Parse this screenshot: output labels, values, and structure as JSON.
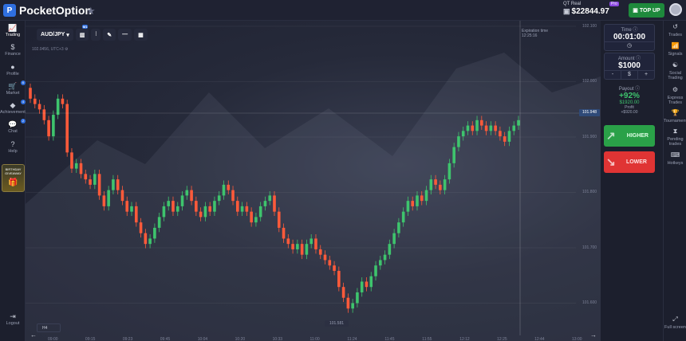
{
  "header": {
    "brand": "PocketOption",
    "brand_letter": "P",
    "account_type": "QT Real",
    "account_pro": "Pro",
    "balance": "$22844.97",
    "topup_label": "TOP UP"
  },
  "sidebar": {
    "items": [
      {
        "label": "Trading",
        "icon": "chart-line-icon",
        "glyph": "📈"
      },
      {
        "label": "Finance",
        "icon": "dollar-icon",
        "glyph": "$"
      },
      {
        "label": "Profile",
        "icon": "user-icon",
        "glyph": "●"
      },
      {
        "label": "Market",
        "icon": "cart-icon",
        "glyph": "🛒",
        "badge": "6"
      },
      {
        "label": "Achievements",
        "icon": "diamond-icon",
        "glyph": "◆",
        "badge": "4"
      },
      {
        "label": "Chat",
        "icon": "chat-icon",
        "glyph": "💬",
        "badge": "2"
      },
      {
        "label": "Help",
        "icon": "help-icon",
        "glyph": "?"
      }
    ],
    "promo": "BIRTHDAY GIVEAWAY",
    "logout": "Logout"
  },
  "toolbar": {
    "pair": "AUD/JPY",
    "badge": "M1"
  },
  "chart_info": {
    "subtitle": "102.0456, UTC+3",
    "expiration_label": "Expiration time",
    "expiration_time": "12:25:16",
    "timeframe": "H4",
    "current_price": "101.948",
    "low_price": "101.581"
  },
  "panel": {
    "time_title": "Time",
    "time_value": "00:01:00",
    "amount_title": "Amount",
    "amount_value": "$1000",
    "amount_minus": "-",
    "amount_currency": "$",
    "amount_plus": "+",
    "payout_title": "Payout",
    "payout_pct": "+92%",
    "payout_amount": "$1920.00",
    "profit_label": "Profit",
    "profit_amount": "+$920.00",
    "higher_label": "HIGHER",
    "lower_label": "LOWER"
  },
  "rightnav": {
    "items": [
      {
        "label": "Trades",
        "icon": "history-icon",
        "glyph": "↺"
      },
      {
        "label": "Signals",
        "icon": "signal-icon",
        "glyph": "📶"
      },
      {
        "label": "Social Trading",
        "icon": "social-icon",
        "glyph": "☯"
      },
      {
        "label": "Express Trades",
        "icon": "express-icon",
        "glyph": "⚙"
      },
      {
        "label": "Tournaments",
        "icon": "trophy-icon",
        "glyph": "🏆"
      },
      {
        "label": "Pending trades",
        "icon": "hourglass-icon",
        "glyph": "⧗"
      },
      {
        "label": "Hotkeys",
        "icon": "keyboard-icon",
        "glyph": "⌨"
      }
    ],
    "fullscreen": "Full screen"
  },
  "axis": {
    "y_ticks": [
      "102.100",
      "102.000",
      "101.900",
      "101.800",
      "101.700",
      "101.600"
    ],
    "x_ticks": [
      "09:00",
      "09:15",
      "09:23",
      "09:45",
      "10:04",
      "10:20",
      "10:33",
      "11:00",
      "11:24",
      "11:45",
      "11:55",
      "12:12",
      "12:25",
      "12:44",
      "13:00"
    ]
  },
  "chart_data": {
    "type": "candlestick",
    "title": "AUD/JPY",
    "ylim": [
      101.55,
      102.12
    ],
    "colors": {
      "up": "#3ec46d",
      "down": "#ff5a3a"
    },
    "closes": [
      101.99,
      101.98,
      101.97,
      101.95,
      101.92,
      101.96,
      101.99,
      101.98,
      101.89,
      101.86,
      101.87,
      101.85,
      101.84,
      101.83,
      101.85,
      101.81,
      101.79,
      101.82,
      101.84,
      101.82,
      101.8,
      101.78,
      101.79,
      101.76,
      101.74,
      101.72,
      101.73,
      101.75,
      101.77,
      101.79,
      101.8,
      101.78,
      101.79,
      101.81,
      101.82,
      101.8,
      101.78,
      101.77,
      101.79,
      101.78,
      101.8,
      101.81,
      101.83,
      101.82,
      101.8,
      101.78,
      101.79,
      101.78,
      101.76,
      101.77,
      101.79,
      101.8,
      101.81,
      101.78,
      101.75,
      101.73,
      101.72,
      101.71,
      101.72,
      101.7,
      101.72,
      101.73,
      101.71,
      101.7,
      101.69,
      101.68,
      101.67,
      101.64,
      101.62,
      101.6,
      101.61,
      101.63,
      101.65,
      101.64,
      101.66,
      101.68,
      101.69,
      101.7,
      101.72,
      101.74,
      101.76,
      101.78,
      101.8,
      101.79,
      101.81,
      101.8,
      101.82,
      101.84,
      101.83,
      101.82,
      101.84,
      101.87,
      101.9,
      101.92,
      101.93,
      101.94,
      101.93,
      101.95,
      101.94,
      101.93,
      101.94,
      101.93,
      101.92,
      101.91,
      101.93,
      101.94,
      101.95
    ]
  }
}
